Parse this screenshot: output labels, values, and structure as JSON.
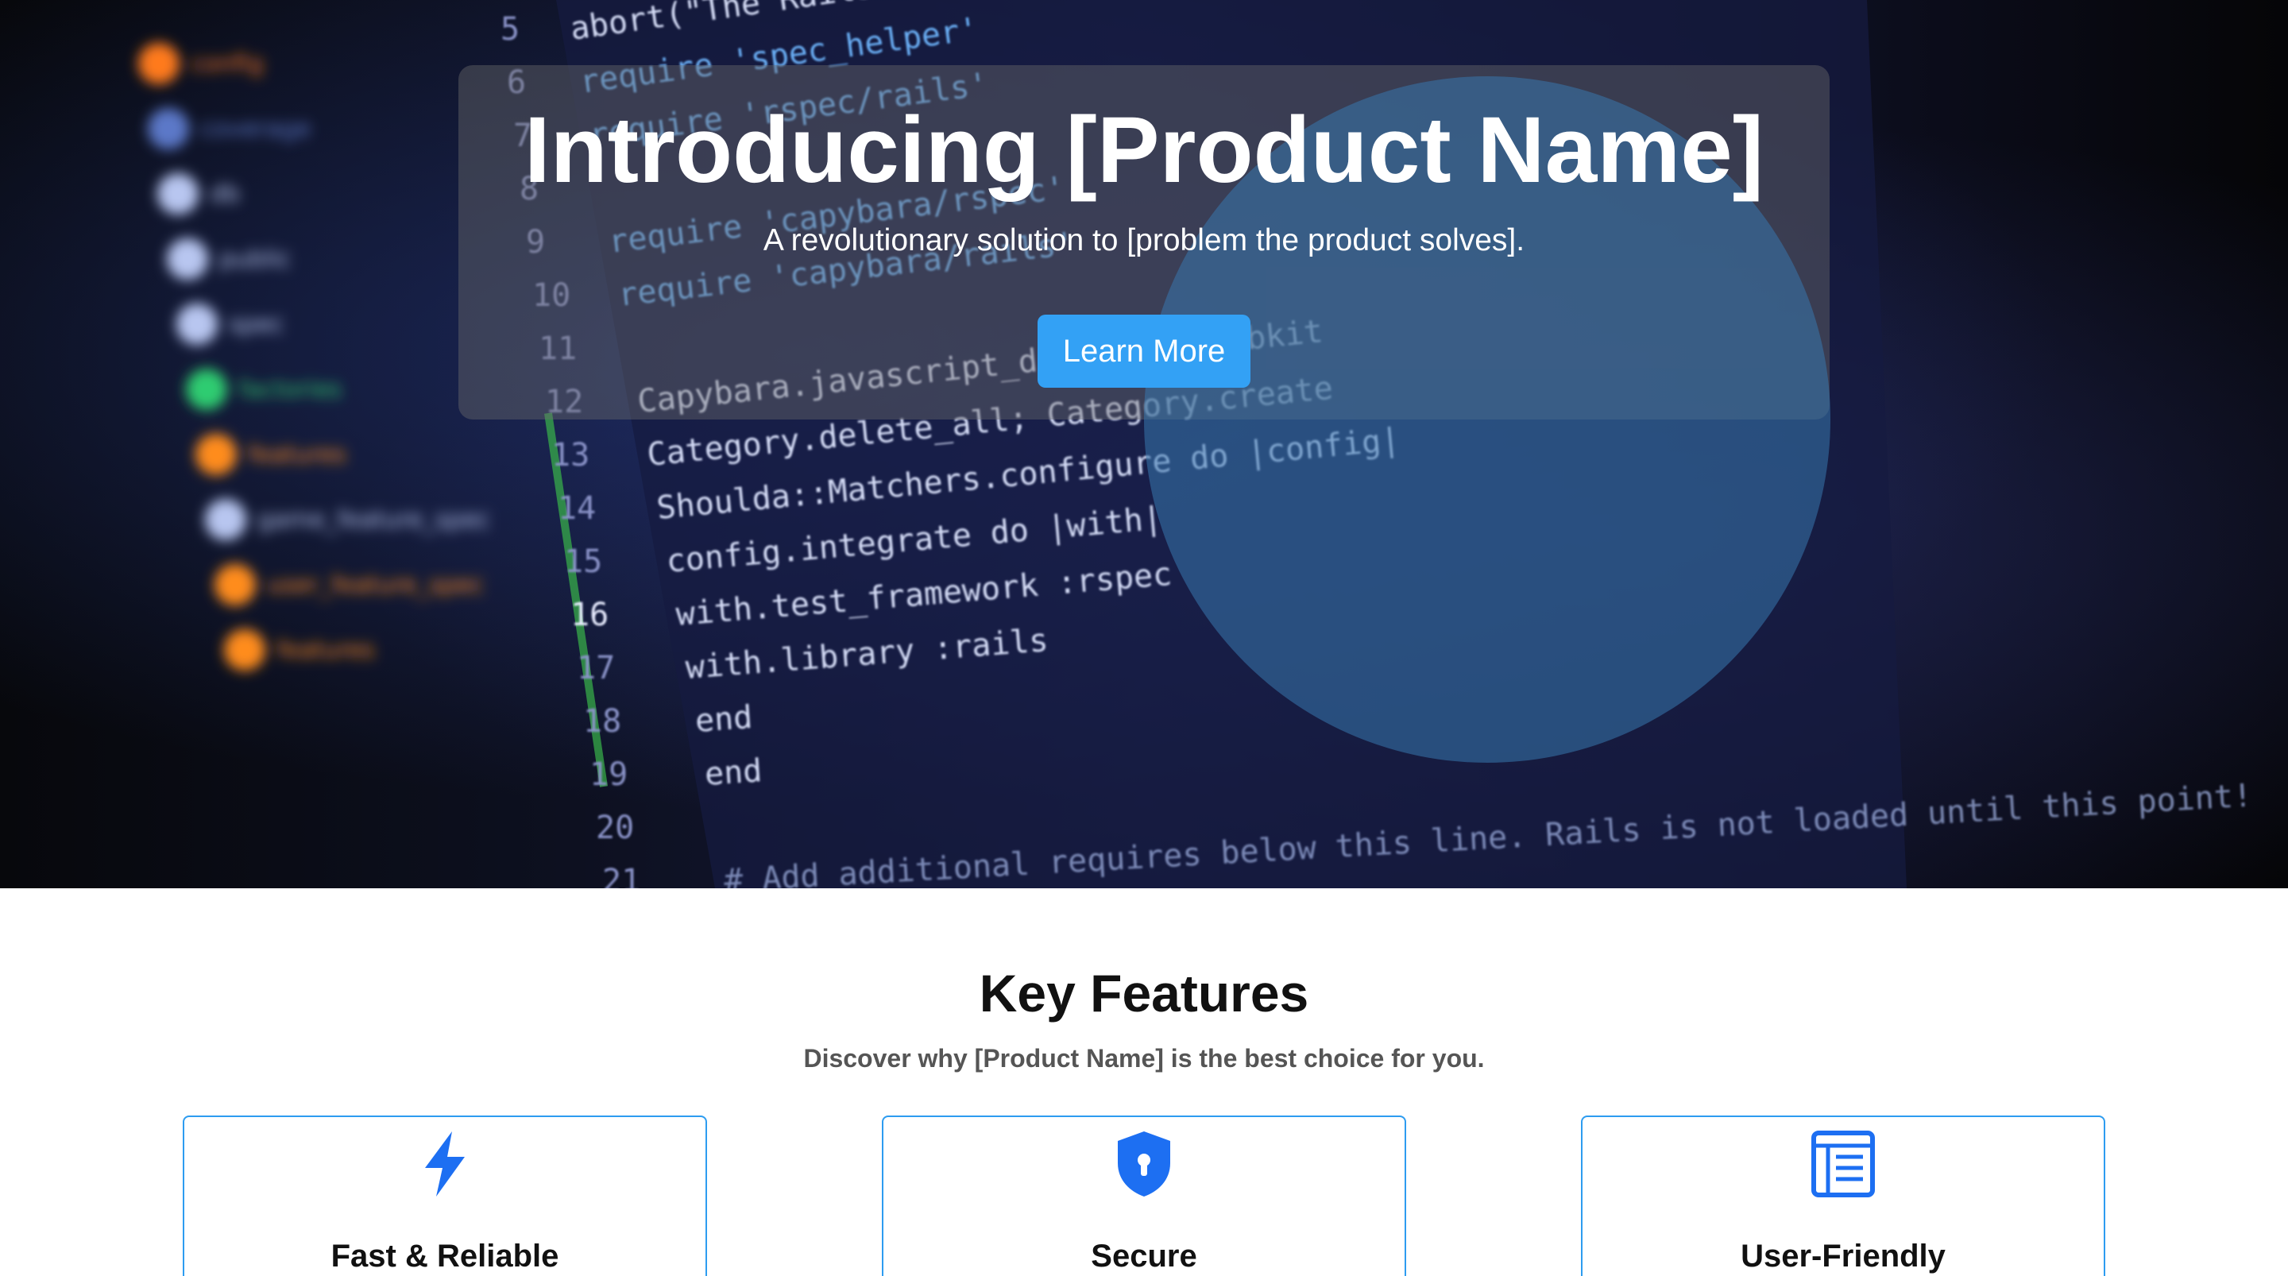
{
  "hero": {
    "title": "Introducing [Product Name]",
    "subtitle": "A revolutionary solution to [problem the product solves].",
    "cta_label": "Learn More",
    "background_image": "blurred-code-editor-photo",
    "code_lines": [
      {
        "num": "5",
        "text": "abort(\"The Rails environment is running in production mode!\")"
      },
      {
        "num": "6",
        "text": "require 'spec_helper'"
      },
      {
        "num": "7",
        "text": "require 'rspec/rails'"
      },
      {
        "num": "8",
        "text": ""
      },
      {
        "num": "9",
        "text": "require 'capybara/rspec'"
      },
      {
        "num": "10",
        "text": "require 'capybara/rails'"
      },
      {
        "num": "11",
        "text": ""
      },
      {
        "num": "12",
        "text": "Capybara.javascript_driver = :webkit"
      },
      {
        "num": "13",
        "text": "Category.delete_all; Category.create"
      },
      {
        "num": "14",
        "text": "Shoulda::Matchers.configure do |config|"
      },
      {
        "num": "15",
        "text": "config.integrate do |with|"
      },
      {
        "num": "16",
        "text": "with.test_framework :rspec"
      },
      {
        "num": "17",
        "text": "with.library :rails"
      },
      {
        "num": "18",
        "text": "end"
      },
      {
        "num": "19",
        "text": "end"
      },
      {
        "num": "20",
        "text": ""
      },
      {
        "num": "21",
        "text": "# Add additional requires below this line. Rails is not loaded until this point!"
      }
    ],
    "sidebar_entries": [
      "config",
      "coverage",
      "db",
      "public",
      "spec",
      "factories",
      "features",
      "game_feature_spec",
      "user_feature_spec",
      "features"
    ]
  },
  "features": {
    "title": "Key Features",
    "subtitle": "Discover why [Product Name] is the best choice for you.",
    "items": [
      {
        "title": "Fast & Reliable",
        "icon": "lightning-bolt-icon"
      },
      {
        "title": "Secure",
        "icon": "shield-lock-icon"
      },
      {
        "title": "User-Friendly",
        "icon": "document-list-icon"
      }
    ]
  },
  "colors": {
    "accent": "#33a1f5",
    "card_border": "#2d9cf0",
    "icon": "#1d6ff2",
    "circle_overlay": "#3878af"
  }
}
